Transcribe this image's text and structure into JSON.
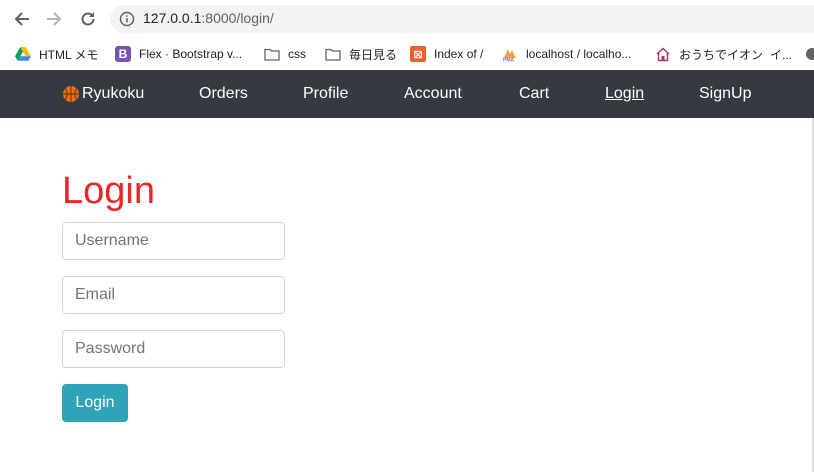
{
  "browser": {
    "url_host": "127.0.0.1",
    "url_rest": ":8000/login/"
  },
  "bookmarks": [
    {
      "label": "HTML メモ",
      "icon": "google-drive-icon"
    },
    {
      "label": "Flex · Bootstrap v...",
      "icon": "bootstrap-icon"
    },
    {
      "label": "css",
      "icon": "folder-icon"
    },
    {
      "label": "毎日見る",
      "icon": "folder-icon"
    },
    {
      "label": "Index of /",
      "icon": "xampp-icon"
    },
    {
      "label": "localhost / localho...",
      "icon": "phpmyadmin-icon"
    },
    {
      "label": "おうちでイオン",
      "icon": "house-icon"
    },
    {
      "label": "イ...",
      "icon": "none"
    }
  ],
  "navbar": {
    "brand": "Ryukoku",
    "links": [
      "Orders",
      "Profile",
      "Account",
      "Cart",
      "Login",
      "SignUp"
    ],
    "active": "Login"
  },
  "main": {
    "title": "Login",
    "fields": {
      "username_placeholder": "Username",
      "email_placeholder": "Email",
      "password_placeholder": "Password"
    },
    "submit_label": "Login"
  },
  "colors": {
    "navbar_bg": "#343a40",
    "title_color": "#e82626",
    "button_bg": "#2fa4b8"
  }
}
